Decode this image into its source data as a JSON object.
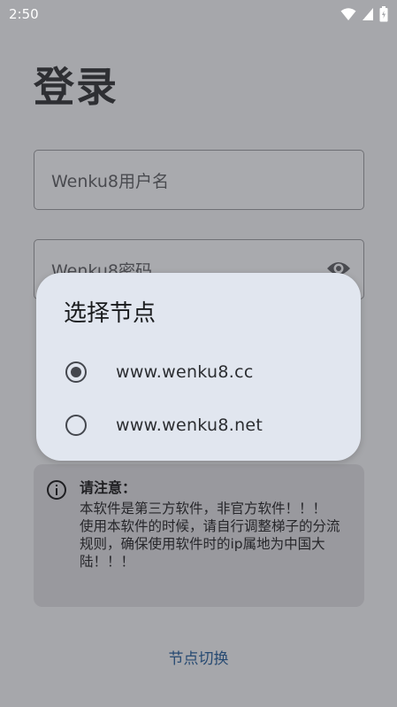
{
  "status_bar": {
    "time": "2:50"
  },
  "login": {
    "title": "登录",
    "username_placeholder": "Wenku8用户名",
    "password_placeholder": "Wenku8密码"
  },
  "notice": {
    "title": "请注意：",
    "body": "本软件是第三方软件，非官方软件！！！\n使用本软件的时候，请自行调整梯子的分流规则，确保使用软件时的ip属地为中国大陆！！！"
  },
  "switch_node_label": "节点切换",
  "dialog": {
    "title": "选择节点",
    "options": [
      {
        "label": "www.wenku8.cc",
        "selected": true
      },
      {
        "label": "www.wenku8.net",
        "selected": false
      }
    ]
  },
  "colors": {
    "scrim_background": "#a6a7ab",
    "dialog_background": "#e1e6ef",
    "link": "#274a72"
  },
  "icons": [
    "wifi-icon",
    "signal-icon",
    "battery-icon",
    "eye-icon",
    "info-icon"
  ]
}
